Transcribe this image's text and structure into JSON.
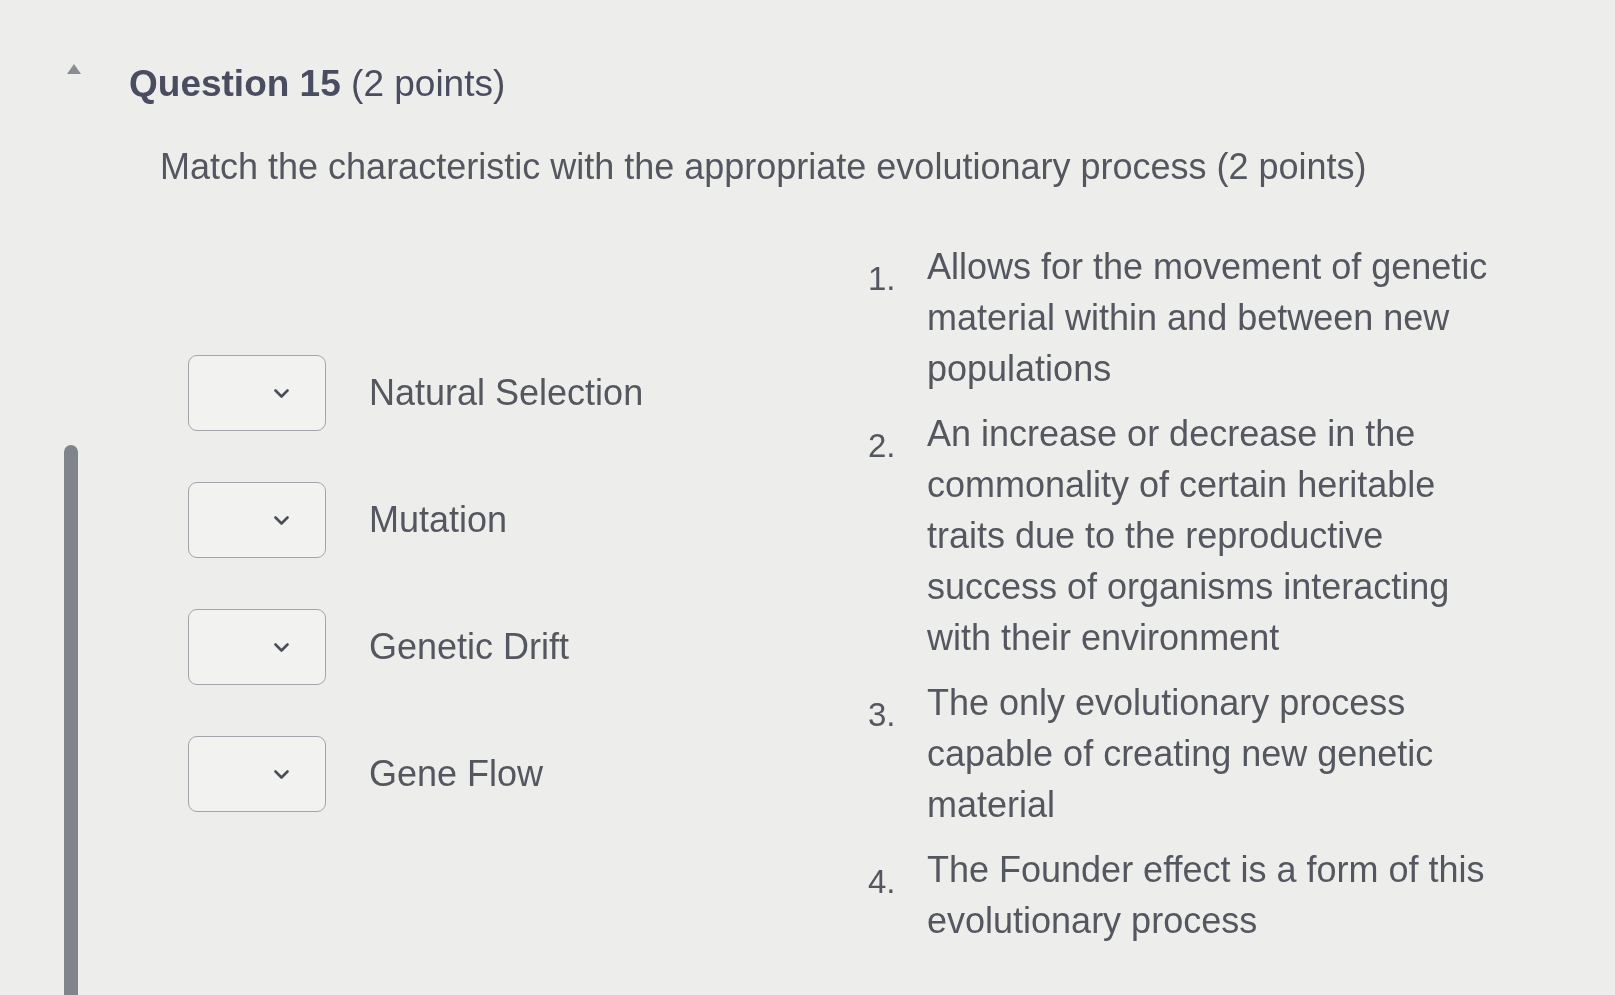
{
  "question": {
    "title": "Question 15",
    "points": "(2 points)"
  },
  "prompt": "Match the characteristic with the appropriate evolutionary process (2 points)",
  "matches": [
    {
      "label": "Natural Selection"
    },
    {
      "label": "Mutation"
    },
    {
      "label": "Genetic Drift"
    },
    {
      "label": "Gene Flow"
    }
  ],
  "choices": [
    {
      "number": "1.",
      "text": "Allows for the movement of genetic material within and between new populations"
    },
    {
      "number": "2.",
      "text": "An increase or decrease in the commonality of certain heritable traits due to the reproductive success of organisms interacting with their environment"
    },
    {
      "number": "3.",
      "text": "The only evolutionary process capable of creating new genetic material"
    },
    {
      "number": "4.",
      "text": "The Founder effect is a form of this evolutionary process"
    }
  ]
}
